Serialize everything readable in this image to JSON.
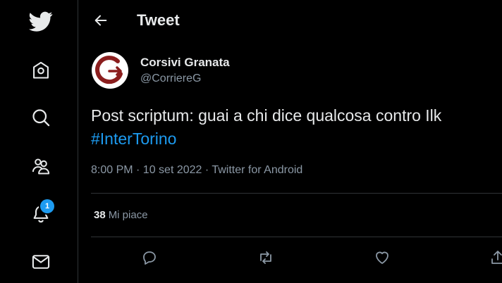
{
  "sidebar": {
    "items": [
      {
        "icon": "twitter-logo-icon"
      },
      {
        "icon": "home-icon"
      },
      {
        "icon": "explore-icon"
      },
      {
        "icon": "communities-icon"
      },
      {
        "icon": "notifications-icon",
        "badge": "1"
      },
      {
        "icon": "messages-icon"
      }
    ]
  },
  "header": {
    "title": "Tweet"
  },
  "tweet": {
    "author": {
      "display_name": "Corsivi Granata",
      "handle": "@CorriereG"
    },
    "text_line1": "Post scriptum: guai a chi dice qualcosa contro Ilk",
    "hashtag": "#InterTorino",
    "timestamp": "8:00 PM · 10 set 2022 · Twitter for Android",
    "likes_count": "38",
    "likes_label": "Mi piace"
  },
  "colors": {
    "accent": "#1d9bf0",
    "background": "#000000",
    "text": "#e7e9ea",
    "secondary_text": "#8b98a5",
    "avatar_logo": "#8b1e1e"
  }
}
